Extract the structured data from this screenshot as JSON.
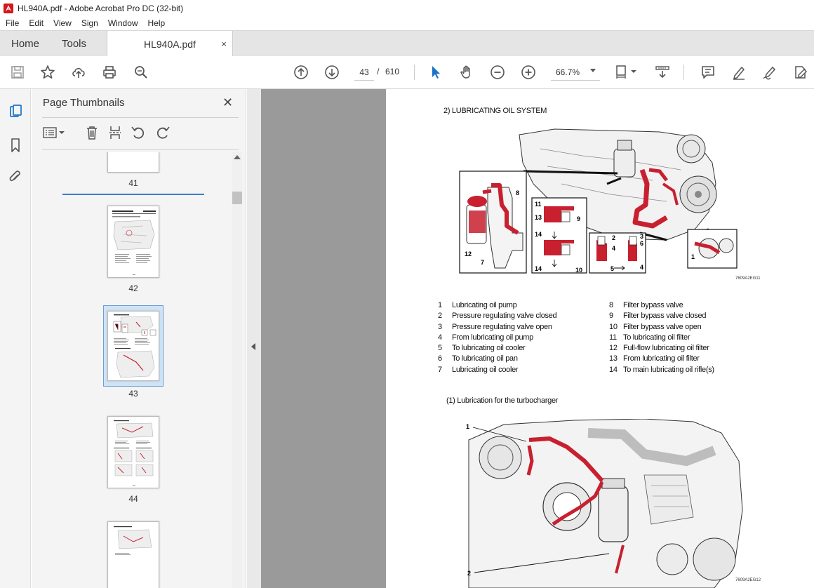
{
  "window": {
    "title": "HL940A.pdf - Adobe Acrobat Pro DC (32-bit)"
  },
  "menu": [
    "File",
    "Edit",
    "View",
    "Sign",
    "Window",
    "Help"
  ],
  "tabs": {
    "home": "Home",
    "tools": "Tools",
    "document": "HL940A.pdf",
    "close_glyph": "×"
  },
  "toolbar": {
    "current_page": "43",
    "page_separator": "/",
    "total_pages": "610",
    "zoom": "66.7%",
    "icons": [
      "save-icon",
      "bookmark-star-icon",
      "upload-icon",
      "print-icon",
      "find-icon",
      "page-up-icon",
      "page-down-icon",
      "select-cursor-icon",
      "hand-icon",
      "zoom-out-icon",
      "zoom-in-icon",
      "page-fit-icon",
      "scroll-mode-icon",
      "comment-icon",
      "highlight-pen-icon",
      "sign-icon",
      "fill-sign-icon"
    ]
  },
  "thumbnail_panel": {
    "title": "Page Thumbnails",
    "close_glyph": "✕",
    "pages": [
      {
        "number": "41"
      },
      {
        "number": "42"
      },
      {
        "number": "43",
        "selected": true
      },
      {
        "number": "44"
      }
    ]
  },
  "document": {
    "section_title": "2) LUBRICATING OIL SYSTEM",
    "figure1_code": "7609A2EG11",
    "callouts_fig1": [
      "8",
      "11",
      "13",
      "9",
      "14",
      "12",
      "7",
      "14",
      "10",
      "2",
      "4",
      "6",
      "3",
      "5",
      "4",
      "1"
    ],
    "legend_left": [
      {
        "num": "1",
        "text": "Lubricating oil pump"
      },
      {
        "num": "2",
        "text": "Pressure regulating valve closed"
      },
      {
        "num": "3",
        "text": "Pressure regulating valve open"
      },
      {
        "num": "4",
        "text": "From lubricating oil pump"
      },
      {
        "num": "5",
        "text": "To lubricating oil cooler"
      },
      {
        "num": "6",
        "text": "To lubricating oil pan"
      },
      {
        "num": "7",
        "text": "Lubricating oil cooler"
      }
    ],
    "legend_right": [
      {
        "num": "8",
        "text": "Filter bypass valve"
      },
      {
        "num": "9",
        "text": "Filter bypass valve closed"
      },
      {
        "num": "10",
        "text": "Filter bypass valve open"
      },
      {
        "num": "11",
        "text": "To lubricating oil filter"
      },
      {
        "num": "12",
        "text": "Full-flow lubricating oil filter"
      },
      {
        "num": "13",
        "text": "From lubricating oil filter"
      },
      {
        "num": "14",
        "text": "To main lubricating oil rifle(s)"
      }
    ],
    "subsection_title": "(1) Lubrication for the turbocharger",
    "figure2_callouts": [
      "1",
      "2"
    ],
    "figure2_code": "7609A2EG12"
  },
  "colors": {
    "accent_red": "#c8202f",
    "selection_blue": "#3b7dc4",
    "toolbar_icon": "#555555"
  }
}
